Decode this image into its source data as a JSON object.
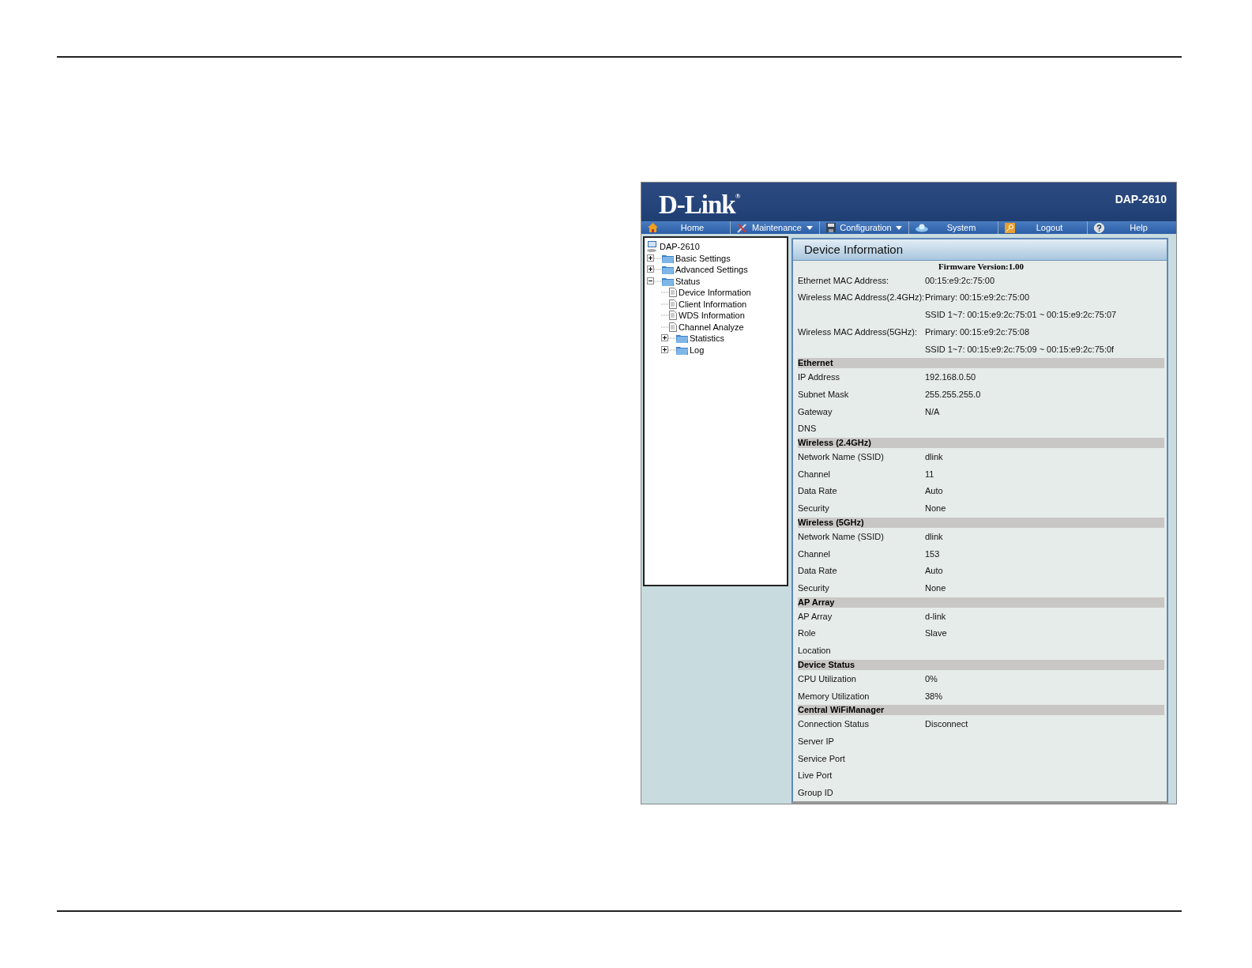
{
  "header": {
    "brand": "D-Link",
    "brand_mark": "®",
    "model": "DAP-2610"
  },
  "nav": [
    {
      "label": "Home",
      "dropdown": false
    },
    {
      "label": "Maintenance",
      "dropdown": true
    },
    {
      "label": "Configuration",
      "dropdown": true
    },
    {
      "label": "System",
      "dropdown": false
    },
    {
      "label": "Logout",
      "dropdown": false
    },
    {
      "label": "Help",
      "dropdown": false
    }
  ],
  "tree": {
    "label": "DAP-2610",
    "children": [
      {
        "label": "Basic Settings",
        "kind": "folder",
        "expanded": false
      },
      {
        "label": "Advanced Settings",
        "kind": "folder",
        "expanded": false
      },
      {
        "label": "Status",
        "kind": "folder",
        "expanded": true,
        "children": [
          {
            "label": "Device Information",
            "kind": "page"
          },
          {
            "label": "Client Information",
            "kind": "page"
          },
          {
            "label": "WDS Information",
            "kind": "page"
          },
          {
            "label": "Channel Analyze",
            "kind": "page"
          },
          {
            "label": "Statistics",
            "kind": "folder",
            "expanded": false
          },
          {
            "label": "Log",
            "kind": "folder",
            "expanded": false
          }
        ]
      }
    ]
  },
  "panel": {
    "title": "Device Information",
    "firmware": "Firmware Version:1.00",
    "info_rows": [
      {
        "label": "Ethernet MAC Address:",
        "value": "00:15:e9:2c:75:00"
      },
      {
        "label": "Wireless MAC Address(2.4GHz):",
        "value": "Primary: 00:15:e9:2c:75:00"
      },
      {
        "value": "SSID 1~7: 00:15:e9:2c:75:01 ~ 00:15:e9:2c:75:07"
      },
      {
        "label": "Wireless MAC Address(5GHz):",
        "value": "Primary: 00:15:e9:2c:75:08"
      },
      {
        "value": "SSID 1~7: 00:15:e9:2c:75:09 ~ 00:15:e9:2c:75:0f"
      }
    ],
    "sections": [
      {
        "title": "Ethernet",
        "rows": [
          {
            "label": "IP Address",
            "value": "192.168.0.50"
          },
          {
            "label": "Subnet Mask",
            "value": "255.255.255.0"
          },
          {
            "label": "Gateway",
            "value": "N/A"
          },
          {
            "label": "DNS"
          }
        ]
      },
      {
        "title": "Wireless (2.4GHz)",
        "rows": [
          {
            "label": "Network Name (SSID)",
            "value": "dlink"
          },
          {
            "label": "Channel",
            "value": "11"
          },
          {
            "label": "Data Rate",
            "value": "Auto"
          },
          {
            "label": "Security",
            "value": "None"
          }
        ]
      },
      {
        "title": "Wireless (5GHz)",
        "rows": [
          {
            "label": "Network Name (SSID)",
            "value": "dlink"
          },
          {
            "label": "Channel",
            "value": "153"
          },
          {
            "label": "Data Rate",
            "value": "Auto"
          },
          {
            "label": "Security",
            "value": "None"
          }
        ]
      },
      {
        "title": "AP Array",
        "rows": [
          {
            "label": "AP Array",
            "value": "d-link"
          },
          {
            "label": "Role",
            "value": "Slave"
          },
          {
            "label": "Location"
          }
        ]
      },
      {
        "title": "Device Status",
        "rows": [
          {
            "label": "CPU Utilization",
            "value": "0%"
          },
          {
            "label": "Memory Utilization",
            "value": "38%"
          }
        ]
      },
      {
        "title": "Central WiFiManager",
        "rows": [
          {
            "label": "Connection Status",
            "value": "Disconnect"
          },
          {
            "label": "Server IP"
          },
          {
            "label": "Service Port"
          },
          {
            "label": "Live Port"
          },
          {
            "label": "Group ID"
          }
        ]
      }
    ]
  }
}
